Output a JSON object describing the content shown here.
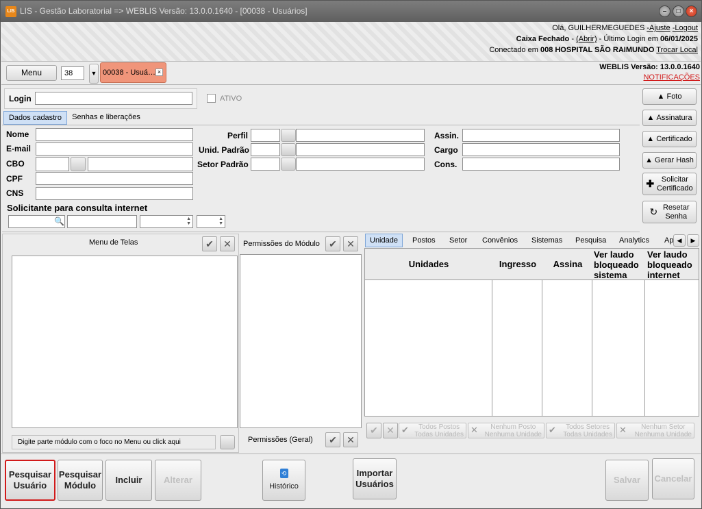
{
  "window": {
    "title": "LIS - Gestão Laboratorial  => WEBLIS Versão: 13.0.0.1640 - [00038 - Usuários]",
    "app_icon": "LIS"
  },
  "header": {
    "greeting": "Olá, GUILHERMEGUEDES",
    "ajuste": "-Ajuste",
    "logout": "-Logout",
    "caixa": "Caixa Fechado",
    "caixa_sep": " - ",
    "abrir": "(Abrir)",
    "ultimo_login_label": " - Último Login em ",
    "ultimo_login": "06/01/2025",
    "conectado_label": "Conectado em ",
    "hospital": "008 HOSPITAL SÃO RAIMUNDO",
    "trocar_local": "Trocar Local"
  },
  "toolbar": {
    "menu_label": "Menu",
    "number_value": "38",
    "tab_label": "00038 - Usuá…",
    "version": "WEBLIS Versão: 13.0.0.1640",
    "notificacoes": "NOTIFICAÇÕES"
  },
  "form": {
    "login_label": "Login",
    "ativo_label": "ATIVO",
    "tabs": [
      "Dados cadastro",
      "Senhas e liberações"
    ],
    "nome": "Nome",
    "email": "E-mail",
    "cbo": "CBO",
    "cpf": "CPF",
    "cns": "CNS",
    "perfil": "Perfil",
    "unid_padrao": "Unid. Padrão",
    "setor_padrao": "Setor Padrão",
    "assin": "Assin.",
    "cargo": "Cargo",
    "cons": "Cons.",
    "solicitante": "Solicitante para consulta internet"
  },
  "side_buttons": {
    "foto": "Foto",
    "assinatura": "Assinatura",
    "certificado": "Certificado",
    "gerar_hash": "Gerar Hash",
    "solicitar_l1": "Solicitar",
    "solicitar_l2": "Certificado",
    "resetar_l1": "Resetar",
    "resetar_l2": "Senha"
  },
  "menu_telas": {
    "title": "Menu de Telas",
    "hint": "Digite parte módulo com o foco no Menu ou click aqui"
  },
  "permissoes": {
    "modulo_title": "Permissões do Módulo",
    "geral_label": "Permissões (Geral)"
  },
  "unit_tabs": [
    "Unidade",
    "Postos",
    "Setor",
    "Convênios",
    "Sistemas",
    "Pesquisa",
    "Analytics",
    "Ap"
  ],
  "grid": {
    "headers": [
      "Unidades",
      "Ingresso",
      "Assina",
      "Ver laudo bloqueado sistema",
      "Ver laudo bloqueado internet"
    ]
  },
  "grid_buttons": {
    "todos_postos_l1": "Todos Postos",
    "todos_postos_l2": "Todas Unidades",
    "nenhum_posto_l1": "Nenhum Posto",
    "nenhum_posto_l2": "Nenhuma Unidade",
    "todos_setores_l1": "Todos Setores",
    "todos_setores_l2": "Todas Unidades",
    "nenhum_setor_l1": "Nenhum Setor",
    "nenhum_setor_l2": "Nenhuma Unidade"
  },
  "bottom": {
    "pesquisar_usuario_l1": "Pesquisar",
    "pesquisar_usuario_l2": "Usuário",
    "pesquisar_modulo_l1": "Pesquisar",
    "pesquisar_modulo_l2": "Módulo",
    "incluir": "Incluir",
    "alterar": "Alterar",
    "historico": "Histórico",
    "importar_l1": "Importar",
    "importar_l2": "Usuários",
    "salvar": "Salvar",
    "cancelar": "Cancelar"
  },
  "colors": {
    "tab_active": "#f0957a",
    "highlight": "#d11a1a",
    "unidade_tab": "#cfe0f5"
  }
}
